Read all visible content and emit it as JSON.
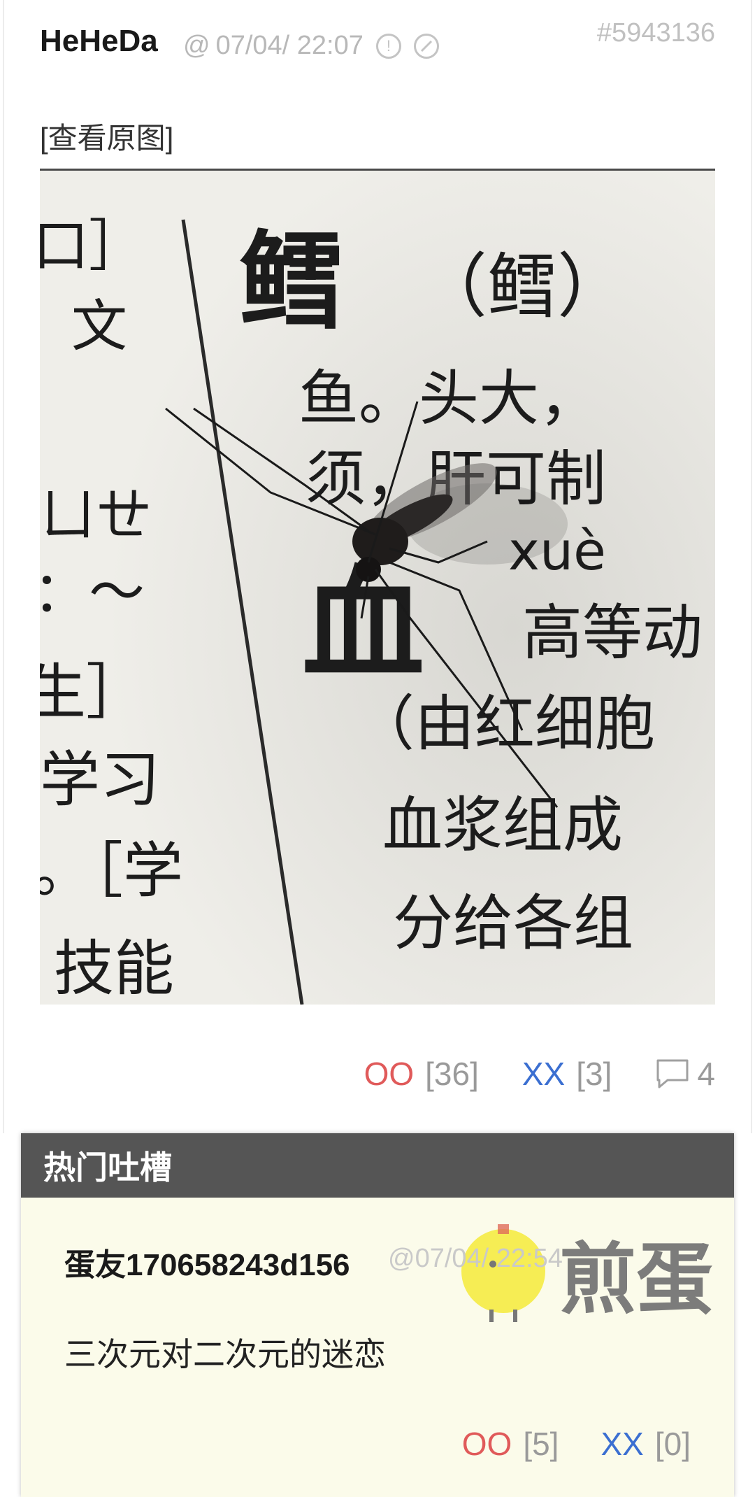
{
  "post": {
    "author": "HeHeDa",
    "at": "@",
    "time": "07/04/ 22:07",
    "id": "#5943136",
    "view_original": "[查看原图]",
    "image_text": {
      "headword": "鳕",
      "headword_alt": "（鳕）",
      "line1": "鱼。头大，",
      "line2": "须，肝可制",
      "pinyin": "xuè",
      "big_char": "血",
      "line3": "高等动",
      "line4": "（由红细胞",
      "line5": "血浆组成",
      "line6": "分给各组",
      "left1": "口］",
      "left2": "文",
      "left3": "ㄩㄝ",
      "left4": "：～",
      "left5": "生］",
      "left6": "学习",
      "left7": "。［学",
      "left8": "技能"
    },
    "votes": {
      "oo_label": "OO",
      "oo_count": "[36]",
      "xx_label": "XX",
      "xx_count": "[3]",
      "comments": "4"
    }
  },
  "hot_comments": {
    "title": "热门吐槽",
    "items": [
      {
        "author": "蛋友170658243d156",
        "time": "@07/04/ 22:54",
        "text": "三次元对二次元的迷恋",
        "oo_label": "OO",
        "oo_count": "[5]",
        "xx_label": "XX",
        "xx_count": "[0]"
      }
    ],
    "watermark": "煎蛋"
  },
  "colors": {
    "oo": "#e05a5a",
    "xx": "#3b6fd1",
    "hot_header_bg": "#555555",
    "hot_body_bg": "#fbfbea"
  },
  "icons": [
    "report-icon",
    "block-icon",
    "comment-icon",
    "chick-mascot-icon"
  ]
}
